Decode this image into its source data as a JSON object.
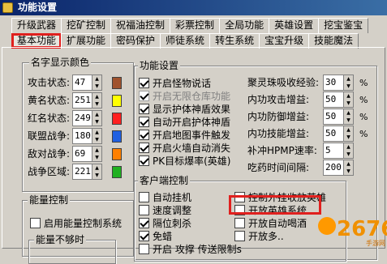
{
  "window": {
    "title": "功能设置"
  },
  "tabs": {
    "row1": [
      "升级武器",
      "挖矿控制",
      "祝福油控制",
      "彩票控制",
      "全局功能",
      "英雄设置",
      "挖宝鉴宝"
    ],
    "row2": [
      "基本功能",
      "扩展功能",
      "密码保护",
      "师徒系统",
      "转生系统",
      "宝宝升级",
      "技能魔法"
    ],
    "active": "基本功能"
  },
  "name_colors": {
    "legend": "名字显示颜色",
    "rows": [
      {
        "label": "攻击状态:",
        "value": "47",
        "color": "#a0522d"
      },
      {
        "label": "黄名状态:",
        "value": "251",
        "color": "#ffff00"
      },
      {
        "label": "红名状态:",
        "value": "249",
        "color": "#ff2020"
      },
      {
        "label": "联盟战争:",
        "value": "180",
        "color": "#2060e0"
      },
      {
        "label": "敌对战争:",
        "value": "69",
        "color": "#ff8000"
      },
      {
        "label": "战争区域:",
        "value": "221",
        "color": "#20b020"
      }
    ]
  },
  "energy": {
    "legend": "能量控制",
    "enable_label": "启用能量控制系统",
    "sub_legend": "能量不够时"
  },
  "features": {
    "legend": "功能设置",
    "checks": [
      {
        "label": "开启怪物说话",
        "checked": true,
        "disabled": false
      },
      {
        "label": "开启无限仓库功能",
        "checked": true,
        "disabled": true
      },
      {
        "label": "显示护体神盾效果",
        "checked": true,
        "disabled": false
      },
      {
        "label": "自动开启护体神盾",
        "checked": true,
        "disabled": false
      },
      {
        "label": "开启地图事件触发",
        "checked": true,
        "disabled": false
      },
      {
        "label": "开启火墙自动消失",
        "checked": true,
        "disabled": false
      },
      {
        "label": "PK目标爆率(英雄)",
        "checked": true,
        "disabled": false
      }
    ],
    "fields": [
      {
        "label": "聚灵珠吸收经验:",
        "value": "30",
        "unit": "%"
      },
      {
        "label": "内功攻击增益:",
        "value": "50",
        "unit": "%"
      },
      {
        "label": "内功防御增益:",
        "value": "50",
        "unit": "%"
      },
      {
        "label": "内功技能增益:",
        "value": "50",
        "unit": "%"
      },
      {
        "label": "补冲HPMP速率:",
        "value": "5",
        "unit": ""
      },
      {
        "label": "吃药时间间隔:",
        "value": "200",
        "unit": ""
      }
    ]
  },
  "client": {
    "legend": "客户端控制",
    "left": [
      {
        "label": "自动挂机",
        "checked": false
      },
      {
        "label": "速度调整",
        "checked": false
      },
      {
        "label": "隔位刺杀",
        "checked": true
      },
      {
        "label": "免蜡",
        "checked": true
      }
    ],
    "right": [
      {
        "label": "控制外挂收放英雄",
        "checked": false
      },
      {
        "label": "开放英雄系统",
        "checked": false
      },
      {
        "label": "开放自动喝酒",
        "checked": false
      },
      {
        "label": "开放多..",
        "checked": false
      }
    ],
    "bottom_label": "开启 攻撑 传送限制s"
  },
  "watermark": {
    "text": "2676",
    "sub": "手游网"
  }
}
